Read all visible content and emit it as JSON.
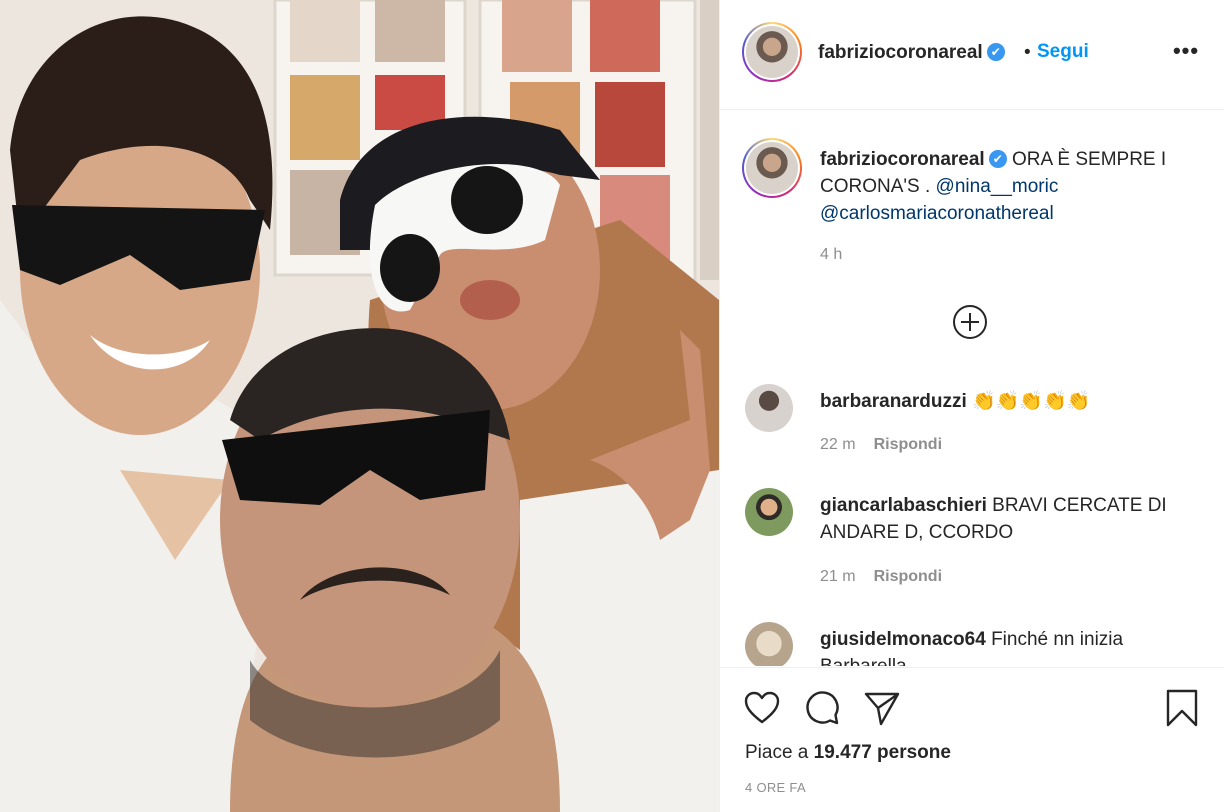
{
  "post": {
    "username": "fabriziocoronareal",
    "verified_mark": "✔",
    "dot": "•",
    "follow_label": "Segui",
    "more_label": "•••",
    "caption_text": "ORA È SEMPRE I CORONA'S .",
    "mention_1": "@nina__moric",
    "mention_2": "@carlosmariacoronathereal",
    "caption_time": "4 h"
  },
  "comments": [
    {
      "username": "barbaranarduzzi",
      "text": "👏👏👏👏👏",
      "time": "22 m",
      "reply_label": "Rispondi"
    },
    {
      "username": "giancarlabaschieri",
      "text": "BRAVI CERCATE DI ANDARE D, CCORDO",
      "time": "21 m",
      "reply_label": "Rispondi"
    },
    {
      "username": "giusidelmonaco64",
      "text": "Finché nn inizia Barbarella"
    }
  ],
  "footer": {
    "likes_prefix": "Piace a ",
    "likes_count": "19.477 persone",
    "post_time": "4 ORE FA"
  },
  "icons": {
    "heart": "heart-icon",
    "comment": "comment-icon",
    "share": "paper-plane-icon",
    "save": "bookmark-icon",
    "load_more": "plus-circle-icon",
    "more": "more-horizontal-icon"
  },
  "colors": {
    "accent": "#0095f6",
    "verified": "#3897f0",
    "muted": "#8e8e8e",
    "text": "#262626",
    "mention": "#00376b"
  }
}
